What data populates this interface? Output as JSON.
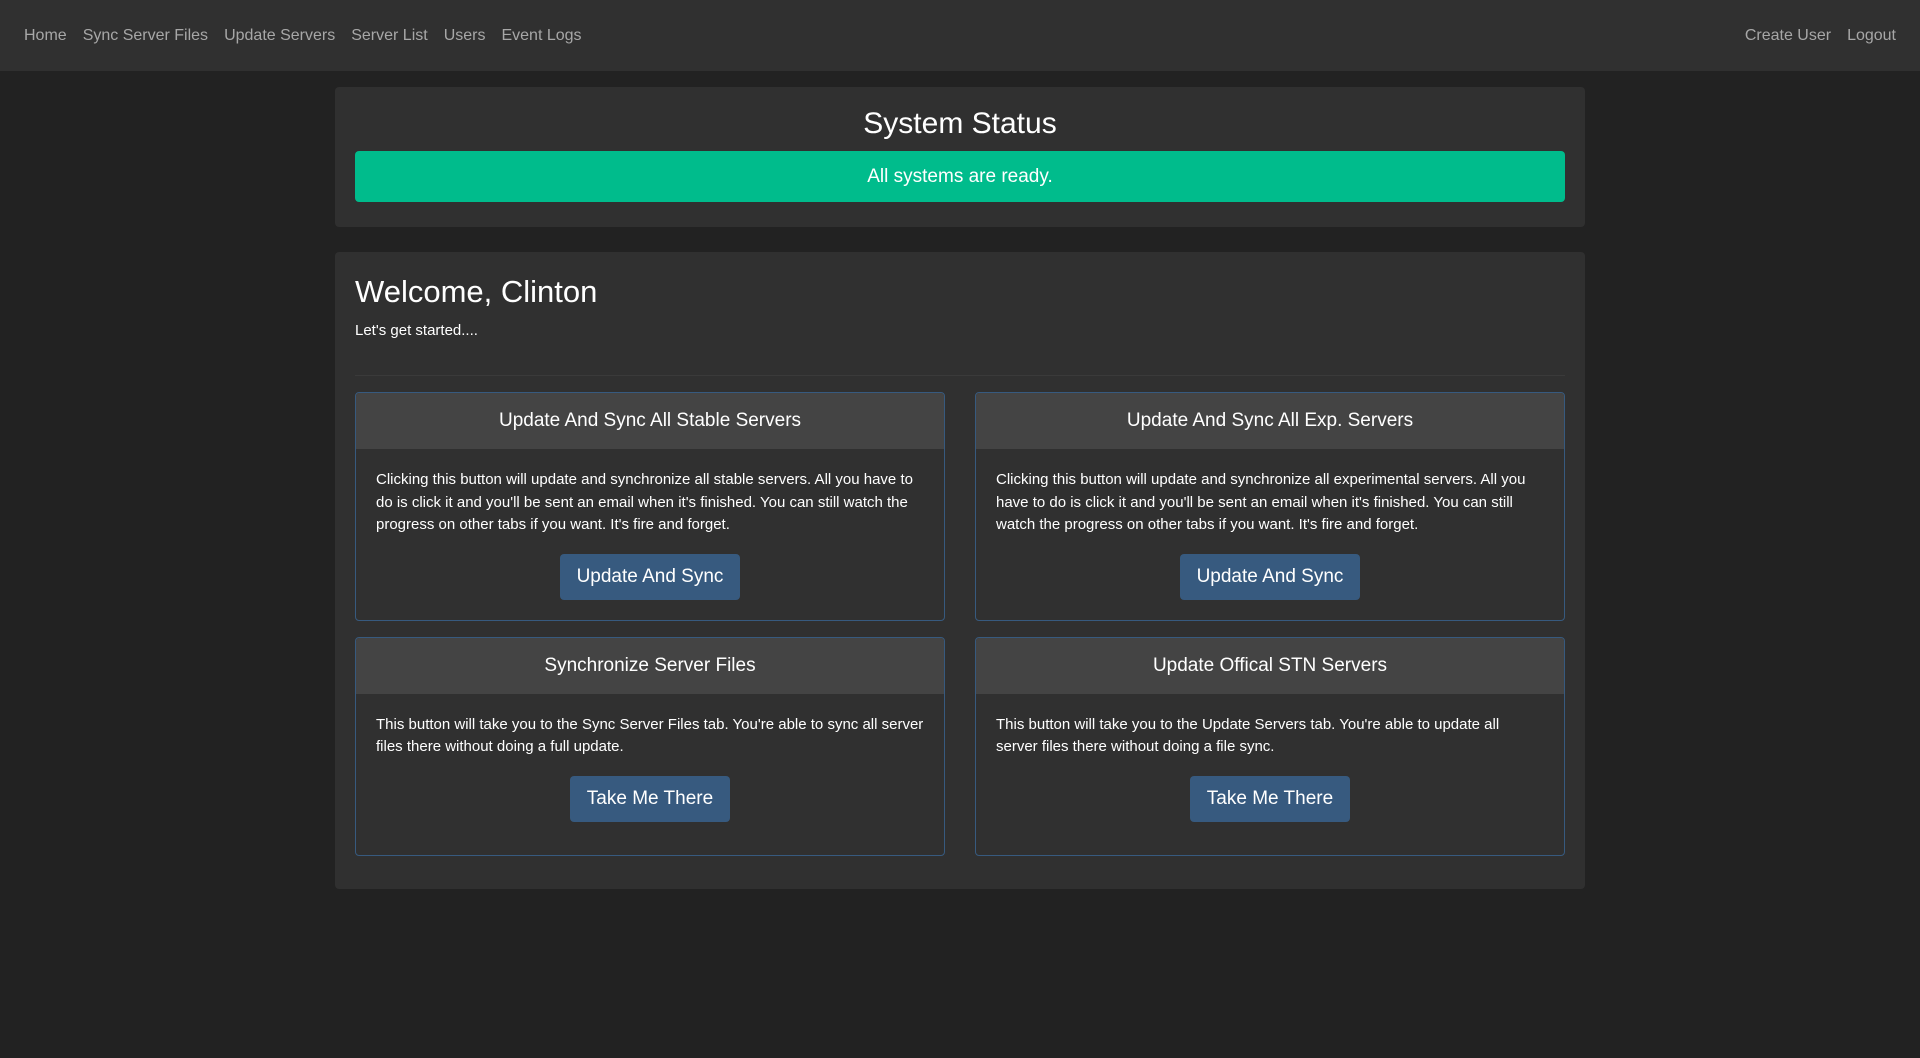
{
  "nav": {
    "left": [
      "Home",
      "Sync Server Files",
      "Update Servers",
      "Server List",
      "Users",
      "Event Logs"
    ],
    "right": [
      "Create User",
      "Logout"
    ]
  },
  "status": {
    "title": "System Status",
    "message": "All systems are ready.",
    "color": "#00bc8c"
  },
  "welcome": {
    "title": "Welcome, Clinton",
    "subtitle": "Let's get started...."
  },
  "cards": [
    {
      "title": "Update And Sync All Stable Servers",
      "text": "Clicking this button will update and synchronize all stable servers. All you have to do is click it and you'll be sent an email when it's finished. You can still watch the progress on other tabs if you want. It's fire and forget.",
      "button": "Update And Sync"
    },
    {
      "title": "Update And Sync All Exp. Servers",
      "text": "Clicking this button will update and synchronize all experimental servers. All you have to do is click it and you'll be sent an email when it's finished. You can still watch the progress on other tabs if you want. It's fire and forget.",
      "button": "Update And Sync"
    },
    {
      "title": "Synchronize Server Files",
      "text": "This button will take you to the Sync Server Files tab. You're able to sync all server files there without doing a full update.",
      "button": "Take Me There"
    },
    {
      "title": "Update Offical STN Servers",
      "text": "This button will take you to the Update Servers tab. You're able to update all server files there without doing a file sync.",
      "button": "Take Me There"
    }
  ],
  "colors": {
    "background": "#222222",
    "navbar": "#303030",
    "panel": "#303030",
    "card_header": "#444444",
    "button": "#375a7f",
    "success": "#00bc8c"
  }
}
